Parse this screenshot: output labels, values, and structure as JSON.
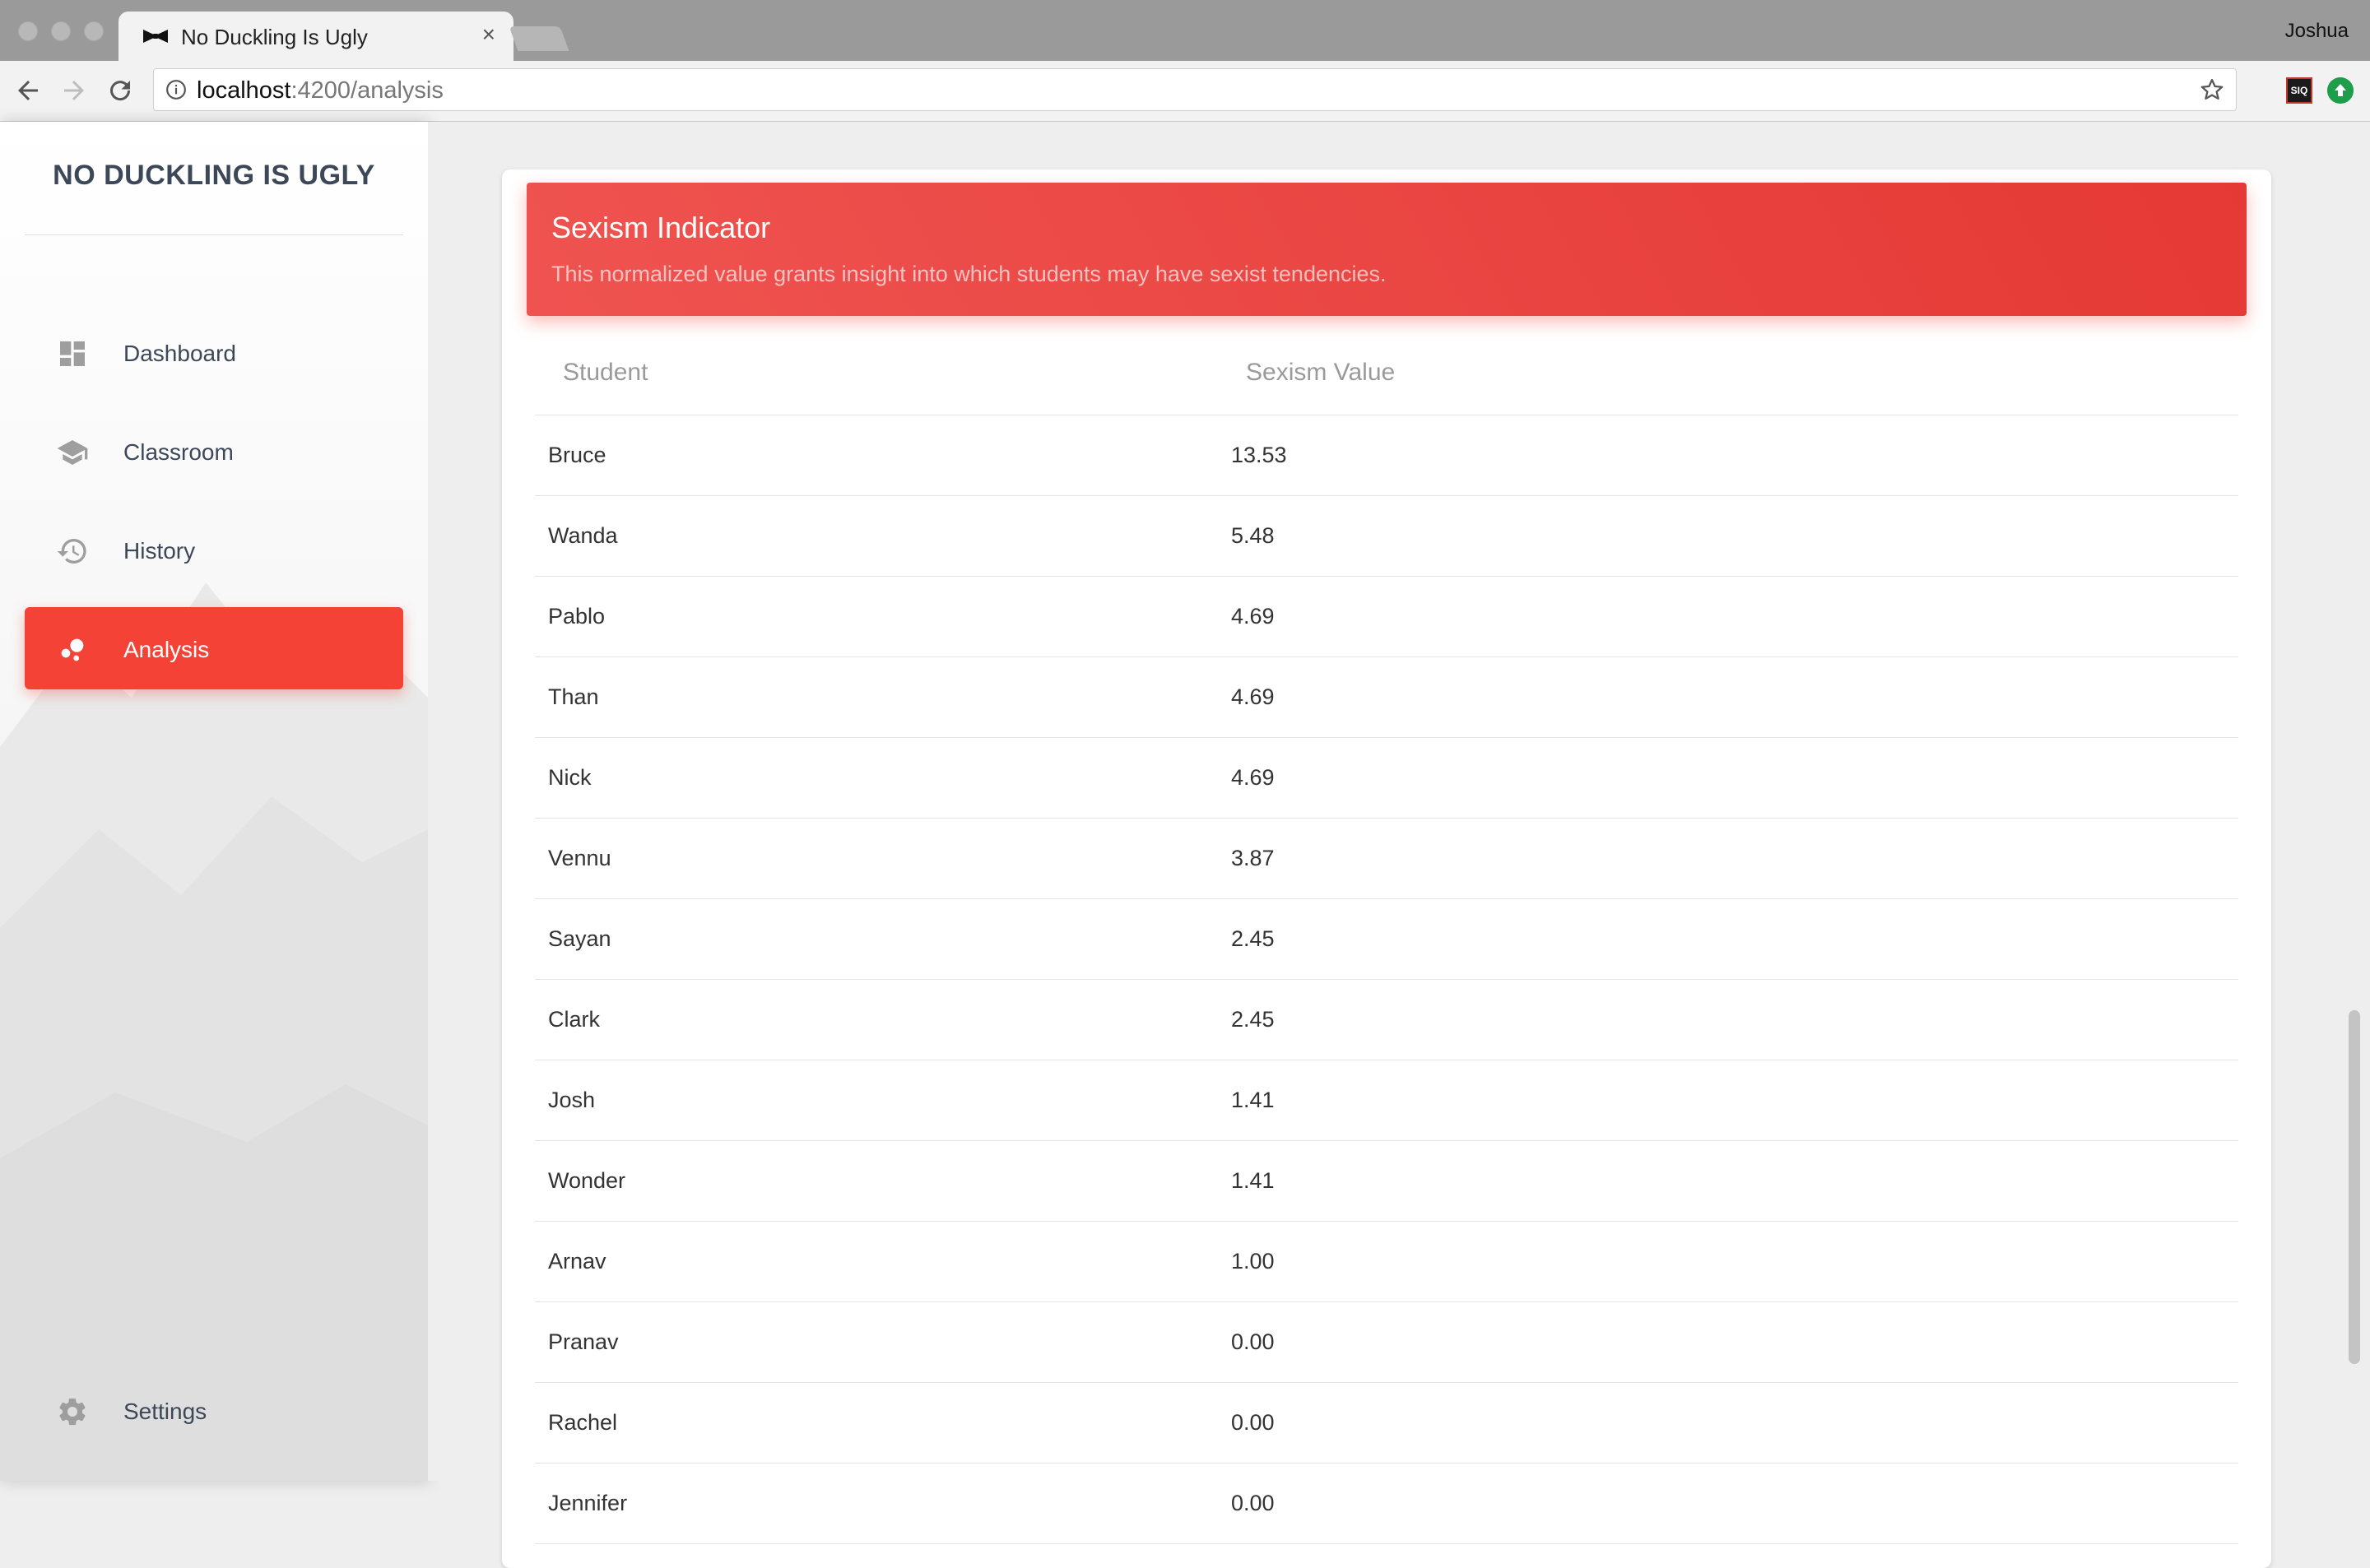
{
  "browser": {
    "tab_title": "No Duckling Is Ugly",
    "tab_close": "×",
    "profile_name": "Joshua",
    "url_host": "localhost",
    "url_path": ":4200/analysis",
    "extension_label": "SIQ"
  },
  "sidebar": {
    "logo": "NO DUCKLING IS UGLY",
    "items": [
      {
        "label": "Dashboard",
        "icon": "dashboard-icon",
        "active": false
      },
      {
        "label": "Classroom",
        "icon": "school-icon",
        "active": false
      },
      {
        "label": "History",
        "icon": "history-icon",
        "active": false
      },
      {
        "label": "Analysis",
        "icon": "bubble-chart-icon",
        "active": true
      }
    ],
    "settings_label": "Settings"
  },
  "card": {
    "title": "Sexism Indicator",
    "subtitle": "This normalized value grants insight into which students may have sexist tendencies.",
    "accent_color": "#f44336"
  },
  "table": {
    "headers": [
      "Student",
      "Sexism Value"
    ],
    "rows": [
      [
        "Bruce",
        "13.53"
      ],
      [
        "Wanda",
        "5.48"
      ],
      [
        "Pablo",
        "4.69"
      ],
      [
        "Than",
        "4.69"
      ],
      [
        "Nick",
        "4.69"
      ],
      [
        "Vennu",
        "3.87"
      ],
      [
        "Sayan",
        "2.45"
      ],
      [
        "Clark",
        "2.45"
      ],
      [
        "Josh",
        "1.41"
      ],
      [
        "Wonder",
        "1.41"
      ],
      [
        "Arnav",
        "1.00"
      ],
      [
        "Pranav",
        "0.00"
      ],
      [
        "Rachel",
        "0.00"
      ],
      [
        "Jennifer",
        "0.00"
      ]
    ]
  }
}
